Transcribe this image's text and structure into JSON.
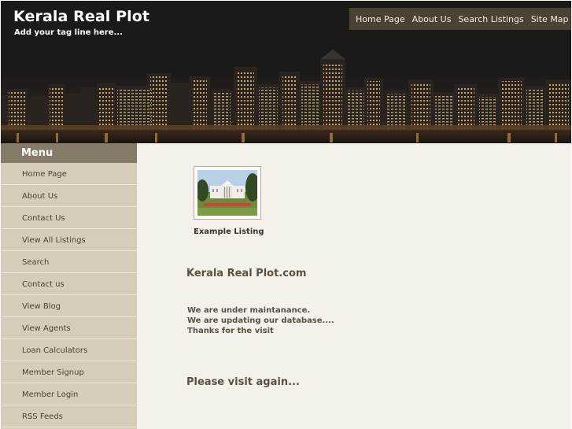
{
  "header": {
    "title": "Kerala Real Plot",
    "tagline": "Add your tag line here..."
  },
  "topnav": [
    {
      "label": "Home Page"
    },
    {
      "label": "About Us"
    },
    {
      "label": "Search Listings"
    },
    {
      "label": "Site Map"
    }
  ],
  "sidebar": {
    "title": "Menu",
    "items": [
      {
        "label": "Home Page"
      },
      {
        "label": "About Us"
      },
      {
        "label": "Contact Us"
      },
      {
        "label": "View All Listings"
      },
      {
        "label": "Search"
      },
      {
        "label": "Contact us"
      },
      {
        "label": "View Blog"
      },
      {
        "label": "View Agents"
      },
      {
        "label": "Loan Calculators"
      },
      {
        "label": "Member Signup"
      },
      {
        "label": "Member Login"
      },
      {
        "label": "RSS Feeds"
      }
    ]
  },
  "main": {
    "listing_caption": "Example Listing",
    "heading": "Kerala Real Plot.com",
    "messages": [
      "We are under maintanance.",
      "We are updating our database....",
      "Thanks for the visit"
    ],
    "closing": "Please visit again..."
  }
}
